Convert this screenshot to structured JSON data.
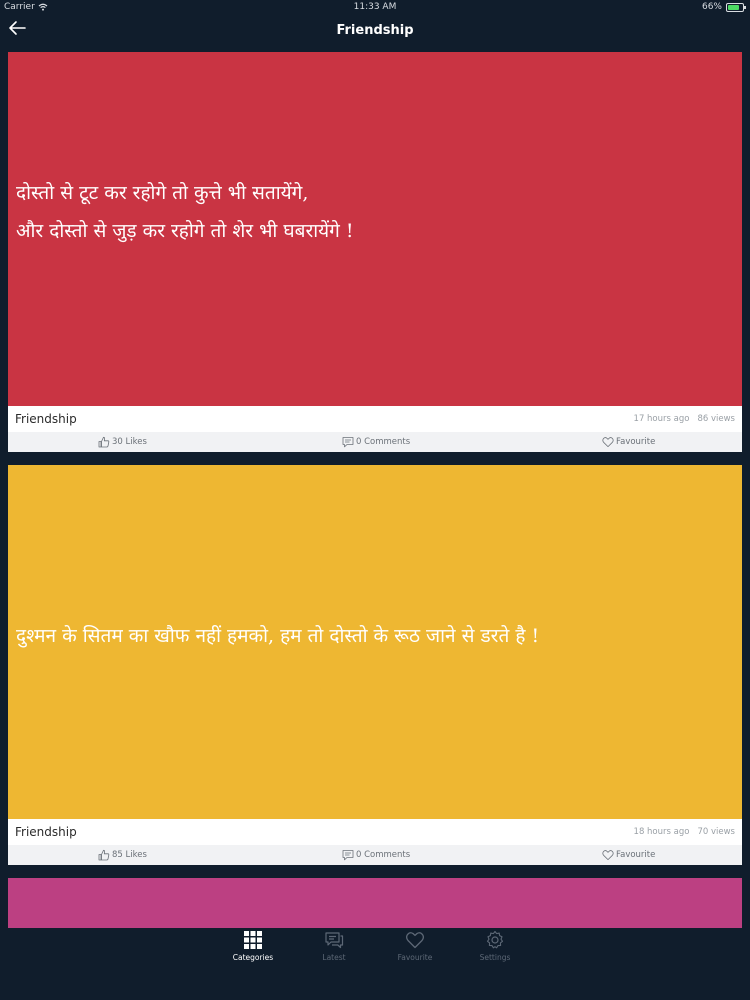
{
  "status": {
    "carrier": "Carrier",
    "time": "11:33 AM",
    "battery": "66%"
  },
  "nav": {
    "title": "Friendship"
  },
  "posts": [
    {
      "bg_color": "#c93443",
      "quote": "दोस्तो से टूट कर रहोगे तो कुत्ते भी सतायेंगे,\nऔर दोस्तो से जुड़ कर रहोगे तो शेर भी घबरायेंगे !",
      "category": "Friendship",
      "time_ago": "17 hours ago",
      "views": "86 views",
      "likes": "30 Likes",
      "comments": "0 Comments",
      "favourite": "Favourite"
    },
    {
      "bg_color": "#eeb732",
      "quote": "दुश्मन के सितम का खौफ नहीं हमको, हम तो दोस्तो के रूठ जाने से डरते है !",
      "category": "Friendship",
      "time_ago": "18 hours ago",
      "views": "70 views",
      "likes": "85 Likes",
      "comments": "0 Comments",
      "favourite": "Favourite"
    }
  ],
  "peek_color": "#bc4082",
  "tabs": [
    {
      "label": "Categories",
      "icon": "grid-icon",
      "active": true
    },
    {
      "label": "Latest",
      "icon": "chat-icon",
      "active": false
    },
    {
      "label": "Favourite",
      "icon": "heart-icon",
      "active": false
    },
    {
      "label": "Settings",
      "icon": "gear-icon",
      "active": false
    }
  ]
}
